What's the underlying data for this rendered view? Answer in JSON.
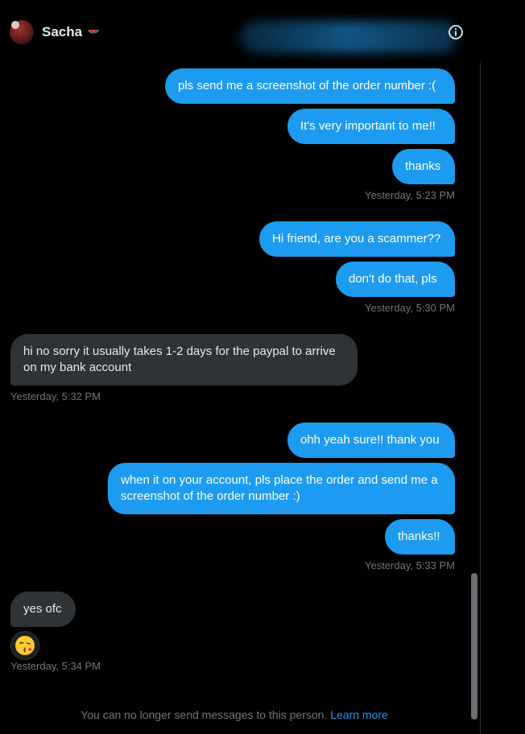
{
  "header": {
    "name": "Sacha",
    "name_emoji": "watermelon-icon",
    "info_icon": "info-icon"
  },
  "messages": [
    {
      "side": "out",
      "text": "pls send me a screenshot of the order number :("
    },
    {
      "side": "out",
      "text": "It's very important to me!!"
    },
    {
      "side": "out",
      "text": "thanks"
    },
    {
      "side": "out",
      "text": "Hi friend, are you a scammer??"
    },
    {
      "side": "out",
      "text": "don't do that, pls"
    },
    {
      "side": "in",
      "text": "hi no sorry it usually takes 1-2 days for the paypal to arrive on my bank account"
    },
    {
      "side": "out",
      "text": "ohh yeah sure!! thank you"
    },
    {
      "side": "out",
      "text": "when it on your account, pls place the order and send me a screenshot of the order number :)"
    },
    {
      "side": "out",
      "text": "thanks!!"
    },
    {
      "side": "in",
      "text": "yes ofc"
    }
  ],
  "timestamps": [
    "Yesterday, 5:23 PM",
    "Yesterday, 5:30 PM",
    "Yesterday, 5:32 PM",
    "Yesterday, 5:33 PM",
    "Yesterday, 5:34 PM"
  ],
  "reaction_emoji": "kissing-face-icon",
  "footer": {
    "text": "You can no longer send messages to this person.",
    "link": "Learn more"
  },
  "colors": {
    "background": "#000000",
    "outgoing_bubble": "#1d9bf0",
    "incoming_bubble": "#2f3336",
    "timestamp": "#71767b",
    "link": "#1d9bf0"
  }
}
